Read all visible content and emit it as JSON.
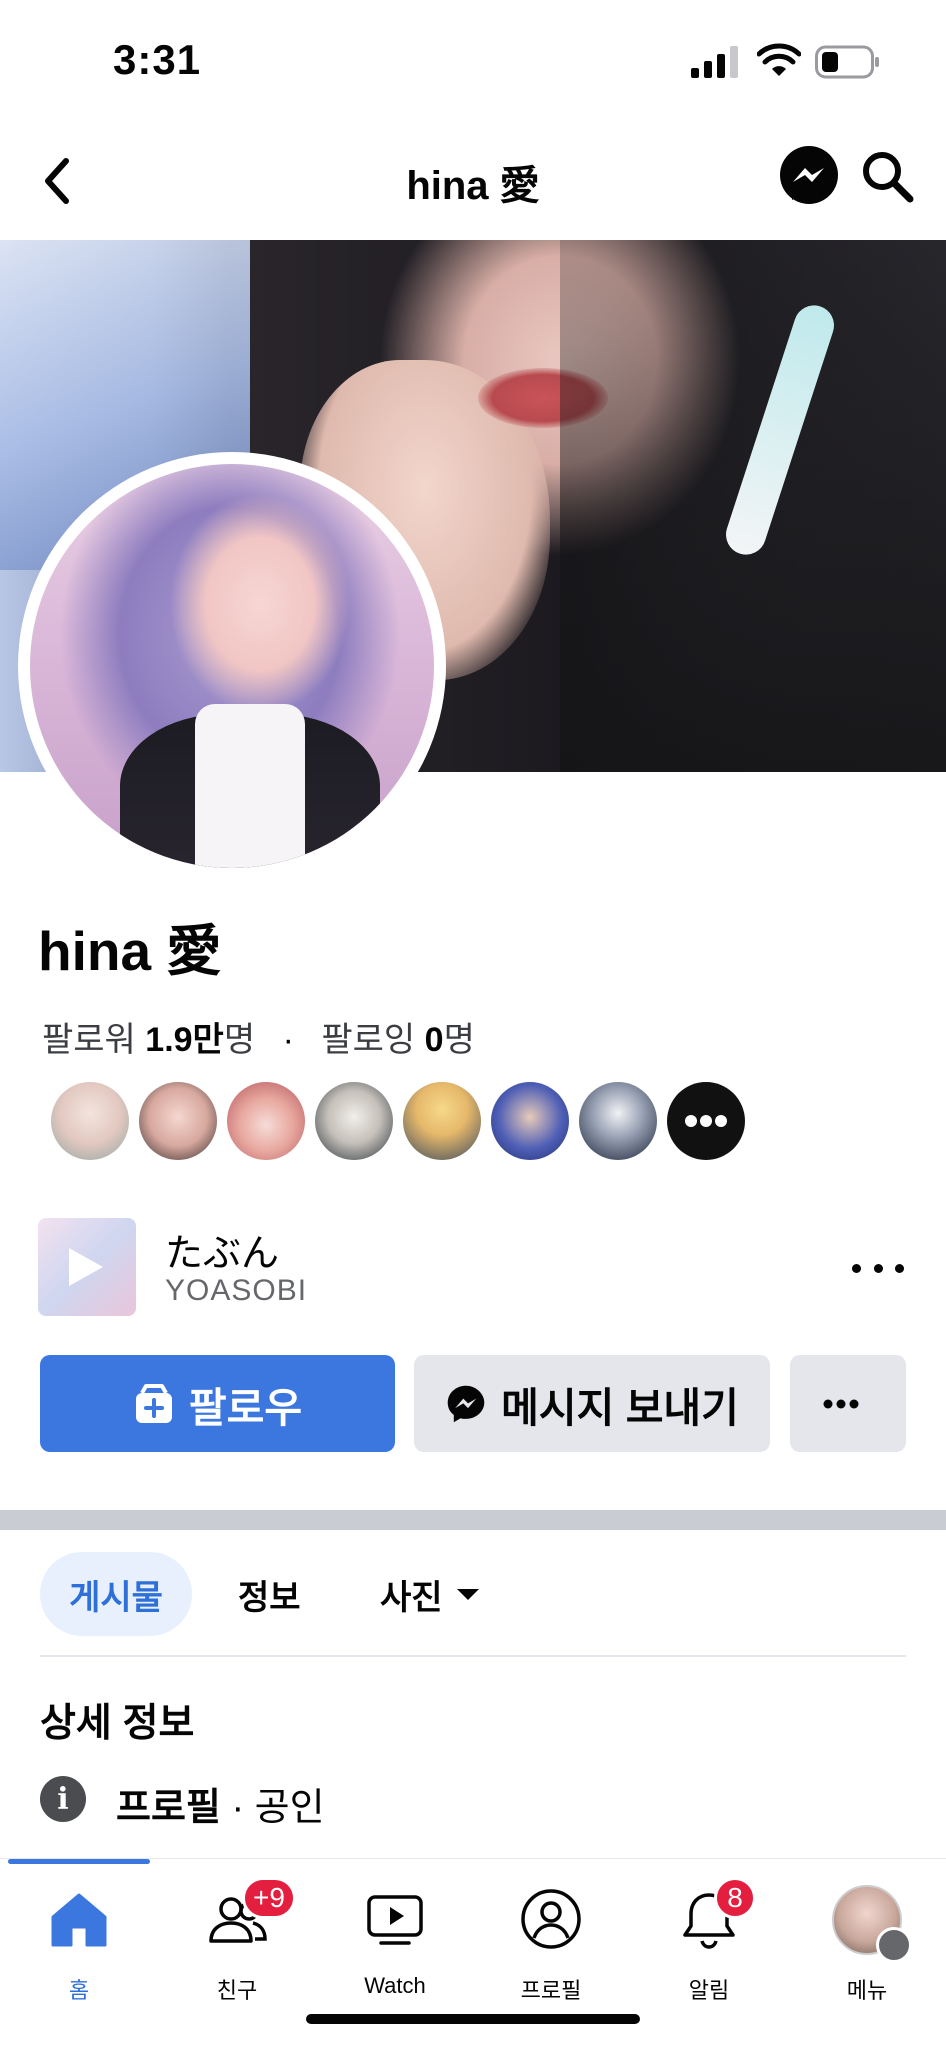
{
  "status_bar": {
    "time": "3:31"
  },
  "header": {
    "title": "hina 愛"
  },
  "profile": {
    "name": "hina 愛",
    "followers_label": "팔로워",
    "followers_count": "1.9만",
    "followers_unit": "명",
    "separator": "·",
    "following_label": "팔로잉",
    "following_count": "0",
    "following_unit": "명"
  },
  "music": {
    "title": "たぶん",
    "artist": "YOASOBI"
  },
  "actions": {
    "follow_label": "팔로우",
    "message_label": "메시지 보내기"
  },
  "tabs": [
    {
      "label": "게시물",
      "active": true
    },
    {
      "label": "정보"
    },
    {
      "label": "사진"
    }
  ],
  "details": {
    "heading": "상세 정보",
    "profile_label": "프로필",
    "profile_category": " · 공인"
  },
  "bottom_nav": [
    {
      "label": "홈",
      "icon": "home-icon",
      "active": true
    },
    {
      "label": "친구",
      "icon": "friends-icon",
      "badge": "+9"
    },
    {
      "label": "Watch",
      "icon": "watch-icon"
    },
    {
      "label": "프로필",
      "icon": "profile-icon"
    },
    {
      "label": "알림",
      "icon": "bell-icon",
      "badge": "8"
    },
    {
      "label": "메뉴",
      "icon": "menu-avatar"
    }
  ],
  "colors": {
    "accent": "#3b77df",
    "badge": "#e41e3f",
    "tab_active_bg": "#e7f0fc"
  }
}
